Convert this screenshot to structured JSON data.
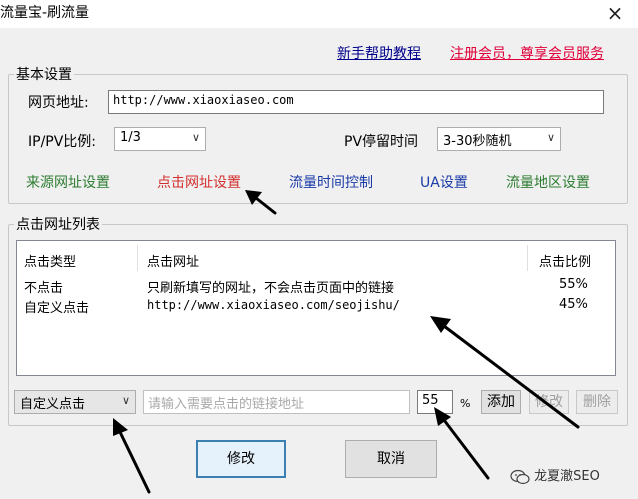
{
  "window": {
    "title": "流量宝-刷流量",
    "close_glyph": "×"
  },
  "header_links": {
    "help": "新手帮助教程",
    "register": "注册会员，尊享会员服务"
  },
  "basic_settings": {
    "legend": "基本设置",
    "url_label": "网页地址:",
    "url_value": "http://www.xiaoxiaseo.com",
    "ippv_label": "IP/PV比例:",
    "ippv_value": "1/3",
    "dwell_label": "PV停留时间",
    "dwell_value": "3-30秒随机",
    "tabs": {
      "source": "来源网址设置",
      "click": "点击网址设置",
      "time": "流量时间控制",
      "ua": "UA设置",
      "region": "流量地区设置"
    }
  },
  "click_list": {
    "legend": "点击网址列表",
    "columns": {
      "type": "点击类型",
      "url": "点击网址",
      "ratio": "点击比例"
    },
    "rows": [
      {
        "type": "不点击",
        "url": "只刷新填写的网址，不会点击页面中的链接",
        "ratio": "55%"
      },
      {
        "type": "自定义点击",
        "url": "http://www.xiaoxiaseo.com/seojishu/",
        "ratio": "45%"
      }
    ]
  },
  "controls": {
    "type_select": "自定义点击",
    "link_placeholder": "请输入需要点击的链接地址",
    "percent_value": "55",
    "percent_unit": "%",
    "add": "添加",
    "modify_small": "修改",
    "delete": "删除"
  },
  "footer": {
    "modify": "修改",
    "cancel": "取消"
  },
  "watermark": {
    "text": "龙夏澈SEO"
  }
}
